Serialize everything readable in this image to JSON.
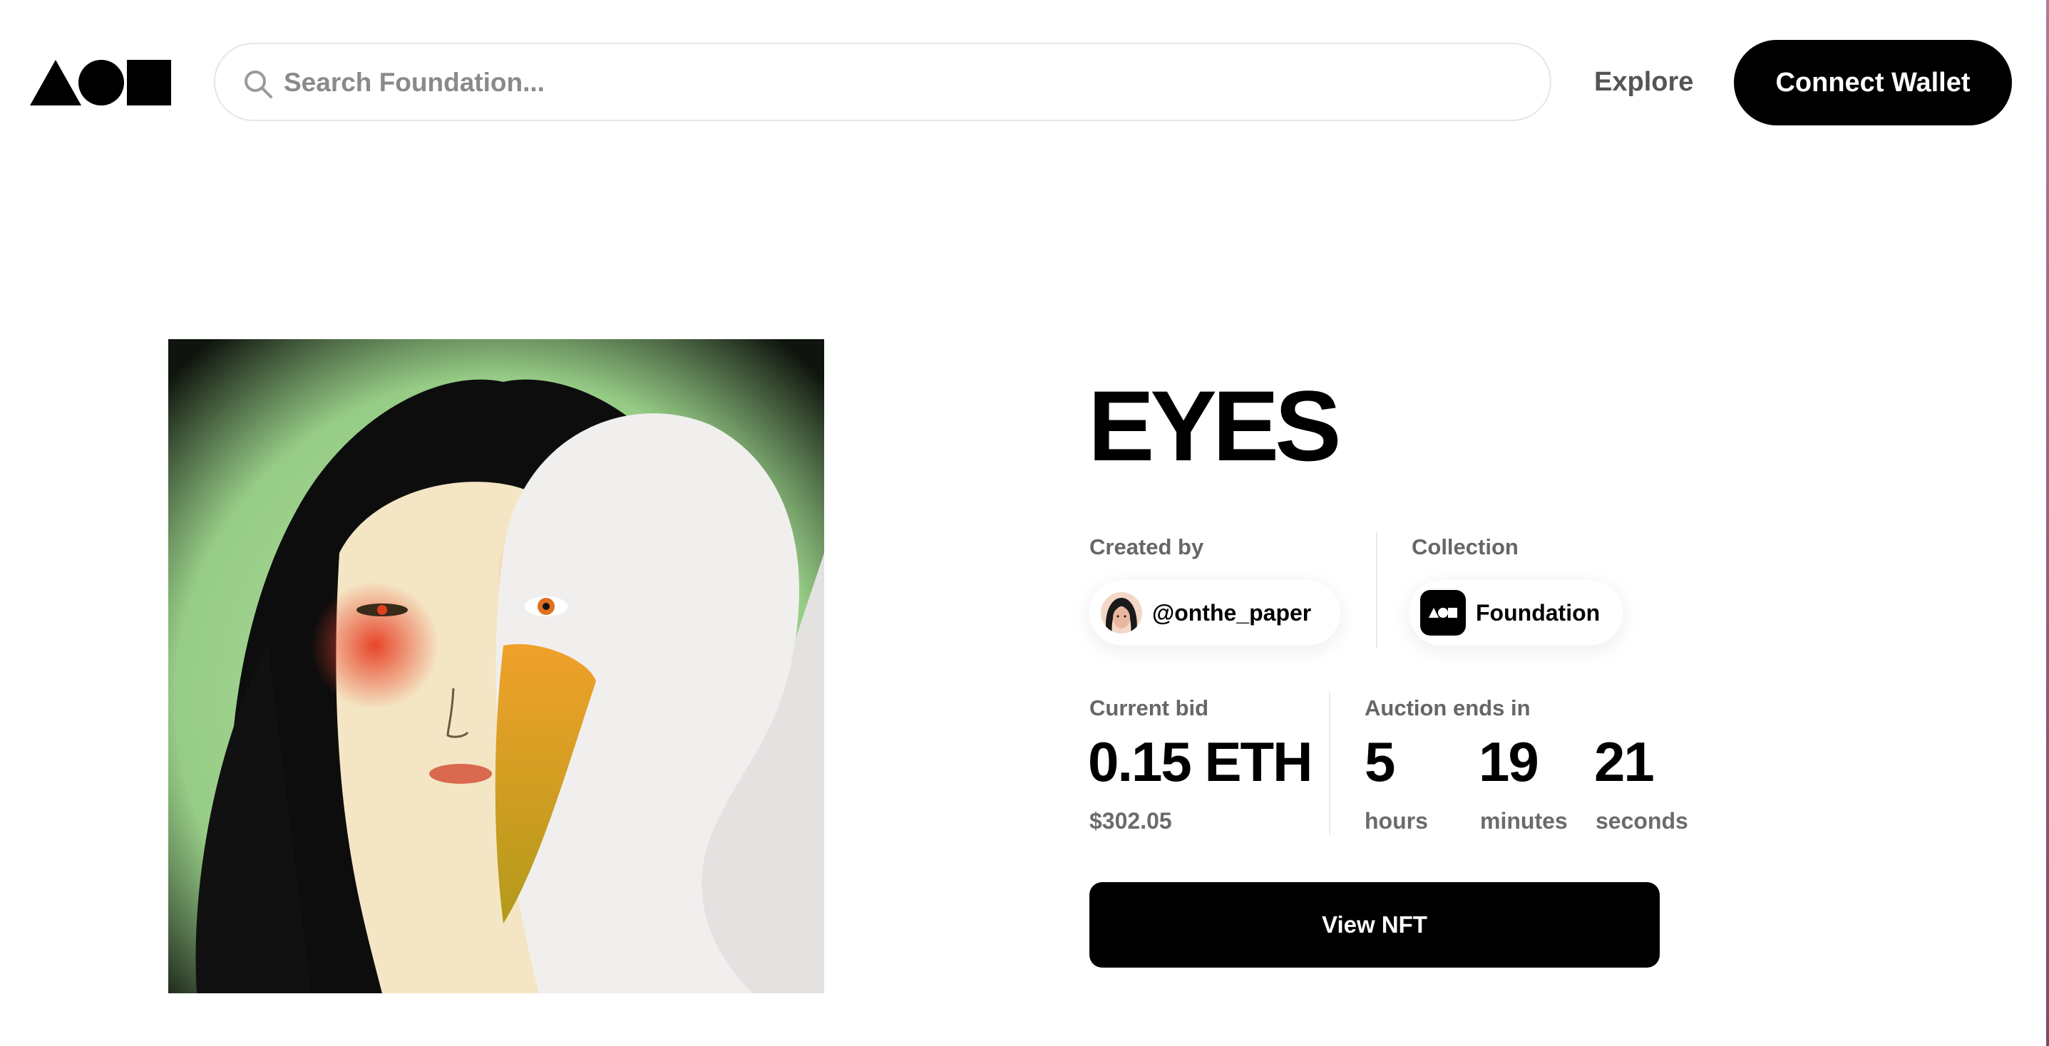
{
  "header": {
    "search_placeholder": "Search Foundation...",
    "nav_explore": "Explore",
    "connect_wallet": "Connect Wallet"
  },
  "nft": {
    "title": "EYES",
    "created_by_label": "Created by",
    "creator": "@onthe_paper",
    "collection_label": "Collection",
    "collection": "Foundation",
    "current_bid_label": "Current bid",
    "current_bid": "0.15 ETH",
    "current_bid_usd": "$302.05",
    "auction_label": "Auction ends in",
    "countdown": {
      "hours_value": "5",
      "hours_label": "hours",
      "minutes_value": "19",
      "minutes_label": "minutes",
      "seconds_value": "21",
      "seconds_label": "seconds"
    },
    "view_button": "View NFT"
  },
  "icons": {
    "logo": "foundation-logo-icon",
    "search": "search-icon"
  },
  "colors": {
    "primary": "#000000",
    "muted_text": "#666666",
    "artwork_bg": "#9ccf8c"
  }
}
